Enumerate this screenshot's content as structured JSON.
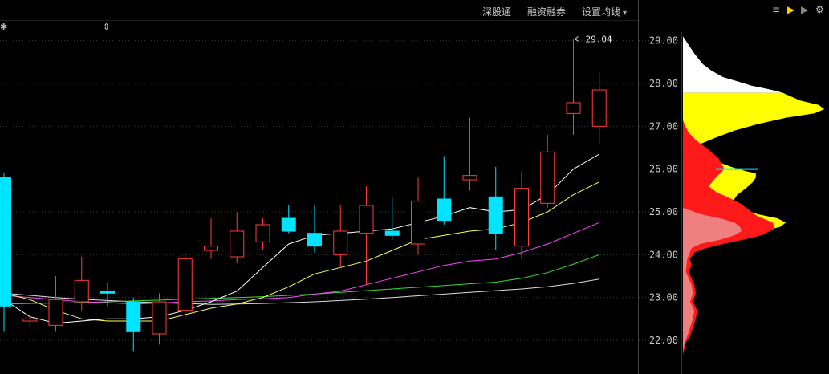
{
  "toolbar": {
    "links": [
      "深股通",
      "融资融券",
      "设置均线"
    ],
    "dropdown_arrow": "▾"
  },
  "side_tools": [
    {
      "name": "list-icon",
      "glyph": "≡",
      "color": "#bbbbbb"
    },
    {
      "name": "play-icon-yellow",
      "glyph": "▶",
      "color": "#ffd000"
    },
    {
      "name": "play-icon-gray",
      "glyph": "▶",
      "color": "#888888"
    },
    {
      "name": "gear-icon",
      "glyph": "⚙",
      "color": "#bbbbbb"
    }
  ],
  "left_glyphs": {
    "star": "✱",
    "updown": "⇕"
  },
  "colors": {
    "up": "#ff3c3c",
    "down": "#00e5ff",
    "ma5": "#ffffff",
    "ma10": "#ffff55",
    "ma20": "#ff44ff",
    "ma30": "#33dd33",
    "ma60": "#dddddd",
    "grid": "#3a3a3a"
  },
  "chart_data": {
    "type": "candlestick",
    "ylim": [
      21.4,
      29.8
    ],
    "y_ticks": [
      "29.00",
      "28.00",
      "27.00",
      "26.00",
      "25.00",
      "24.00",
      "23.00",
      "22.00"
    ],
    "max_label": "29.04",
    "candles": [
      {
        "o": 25.8,
        "h": 25.9,
        "l": 22.2,
        "c": 22.8
      },
      {
        "o": 22.45,
        "h": 22.6,
        "l": 22.3,
        "c": 22.5
      },
      {
        "o": 22.35,
        "h": 23.5,
        "l": 22.2,
        "c": 22.95
      },
      {
        "o": 22.9,
        "h": 23.95,
        "l": 22.7,
        "c": 23.4
      },
      {
        "o": 23.15,
        "h": 23.35,
        "l": 22.8,
        "c": 23.1
      },
      {
        "o": 22.9,
        "h": 23.0,
        "l": 21.75,
        "c": 22.2
      },
      {
        "o": 22.15,
        "h": 23.1,
        "l": 21.9,
        "c": 22.9
      },
      {
        "o": 22.7,
        "h": 24.05,
        "l": 22.5,
        "c": 23.9
      },
      {
        "o": 24.1,
        "h": 24.85,
        "l": 23.9,
        "c": 24.2
      },
      {
        "o": 23.95,
        "h": 25.0,
        "l": 23.8,
        "c": 24.55
      },
      {
        "o": 24.3,
        "h": 24.85,
        "l": 24.1,
        "c": 24.7
      },
      {
        "o": 24.85,
        "h": 25.15,
        "l": 24.5,
        "c": 24.55
      },
      {
        "o": 24.5,
        "h": 25.15,
        "l": 24.05,
        "c": 24.2
      },
      {
        "o": 24.0,
        "h": 25.15,
        "l": 23.7,
        "c": 24.55
      },
      {
        "o": 24.5,
        "h": 25.6,
        "l": 23.3,
        "c": 25.15
      },
      {
        "o": 24.55,
        "h": 25.35,
        "l": 24.35,
        "c": 24.45
      },
      {
        "o": 24.25,
        "h": 25.8,
        "l": 24.0,
        "c": 25.25
      },
      {
        "o": 25.3,
        "h": 26.3,
        "l": 24.7,
        "c": 24.8
      },
      {
        "o": 25.75,
        "h": 27.2,
        "l": 25.5,
        "c": 25.85
      },
      {
        "o": 25.35,
        "h": 26.05,
        "l": 24.1,
        "c": 24.5
      },
      {
        "o": 24.2,
        "h": 25.95,
        "l": 23.9,
        "c": 25.55
      },
      {
        "o": 25.2,
        "h": 26.8,
        "l": 25.1,
        "c": 26.4
      },
      {
        "o": 27.3,
        "h": 29.04,
        "l": 26.8,
        "c": 27.55
      },
      {
        "o": 27.0,
        "h": 28.25,
        "l": 26.6,
        "c": 27.85
      }
    ],
    "ma5": [
      22.95,
      22.55,
      22.4,
      22.45,
      22.5,
      22.5,
      22.55,
      22.7,
      22.9,
      23.15,
      23.7,
      24.25,
      24.45,
      24.5,
      24.55,
      24.6,
      24.75,
      24.9,
      25.1,
      25.0,
      25.05,
      25.4,
      26.0,
      26.35
    ],
    "ma10": [
      23.1,
      22.95,
      22.7,
      22.5,
      22.45,
      22.45,
      22.45,
      22.6,
      22.75,
      22.85,
      23.0,
      23.25,
      23.55,
      23.7,
      23.85,
      24.1,
      24.35,
      24.45,
      24.55,
      24.6,
      24.75,
      25.0,
      25.4,
      25.7
    ],
    "ma20": [
      23.05,
      23.0,
      22.95,
      22.9,
      22.88,
      22.85,
      22.87,
      22.9,
      22.92,
      22.95,
      22.97,
      23.0,
      23.08,
      23.15,
      23.3,
      23.45,
      23.6,
      23.75,
      23.85,
      23.9,
      24.05,
      24.25,
      24.5,
      24.75
    ],
    "ma30": [
      22.85,
      22.86,
      22.87,
      22.88,
      22.9,
      22.92,
      22.94,
      22.96,
      22.98,
      23.0,
      23.02,
      23.05,
      23.08,
      23.12,
      23.16,
      23.2,
      23.24,
      23.28,
      23.32,
      23.36,
      23.45,
      23.58,
      23.78,
      24.0
    ],
    "ma60": [
      23.1,
      23.05,
      23.0,
      22.96,
      22.93,
      22.9,
      22.88,
      22.86,
      22.84,
      22.85,
      22.86,
      22.88,
      22.9,
      22.93,
      22.96,
      23.0,
      23.04,
      23.08,
      23.12,
      23.16,
      23.2,
      23.25,
      23.33,
      23.43
    ],
    "chip_distribution": {
      "white": [
        [
          29.1,
          0
        ],
        [
          28.95,
          0.03
        ],
        [
          28.7,
          0.08
        ],
        [
          28.45,
          0.14
        ],
        [
          28.3,
          0.2
        ],
        [
          28.15,
          0.28
        ],
        [
          28.05,
          0.38
        ],
        [
          27.95,
          0.48
        ],
        [
          27.88,
          0.58
        ],
        [
          27.82,
          0.66
        ],
        [
          27.78,
          0.7
        ]
      ],
      "yellow": [
        [
          27.78,
          0.7
        ],
        [
          27.6,
          0.82
        ],
        [
          27.5,
          0.95
        ],
        [
          27.4,
          0.99
        ],
        [
          27.3,
          0.92
        ],
        [
          27.2,
          0.72
        ],
        [
          27.05,
          0.52
        ],
        [
          26.9,
          0.36
        ],
        [
          26.75,
          0.24
        ],
        [
          26.6,
          0.13
        ],
        [
          26.45,
          0.09
        ],
        [
          26.35,
          0.11
        ],
        [
          26.25,
          0.17
        ],
        [
          26.15,
          0.26
        ],
        [
          26.05,
          0.34
        ],
        [
          25.95,
          0.44
        ],
        [
          25.9,
          0.51
        ],
        [
          25.8,
          0.51
        ],
        [
          25.7,
          0.49
        ],
        [
          25.55,
          0.44
        ],
        [
          25.4,
          0.38
        ],
        [
          25.25,
          0.35
        ],
        [
          25.1,
          0.4
        ],
        [
          24.95,
          0.52
        ],
        [
          24.85,
          0.66
        ],
        [
          24.75,
          0.72
        ],
        [
          24.65,
          0.68
        ],
        [
          24.55,
          0.55
        ],
        [
          24.45,
          0.44
        ],
        [
          24.35,
          0.33
        ],
        [
          24.25,
          0.22
        ],
        [
          24.15,
          0.1
        ],
        [
          24.05,
          0.04
        ],
        [
          23.9,
          0.01
        ]
      ],
      "red": [
        [
          27.15,
          0
        ],
        [
          27.05,
          0.01
        ],
        [
          26.85,
          0.04
        ],
        [
          26.65,
          0.1
        ],
        [
          26.45,
          0.18
        ],
        [
          26.25,
          0.25
        ],
        [
          26.0,
          0.29
        ],
        [
          25.8,
          0.23
        ],
        [
          25.6,
          0.18
        ],
        [
          25.45,
          0.24
        ],
        [
          25.35,
          0.31
        ],
        [
          25.2,
          0.4
        ],
        [
          25.05,
          0.46
        ],
        [
          24.9,
          0.52
        ],
        [
          24.75,
          0.63
        ],
        [
          24.6,
          0.64
        ],
        [
          24.45,
          0.55
        ],
        [
          24.35,
          0.42
        ],
        [
          24.25,
          0.28
        ],
        [
          24.15,
          0.16
        ],
        [
          24.05,
          0.08
        ],
        [
          23.9,
          0.05
        ],
        [
          23.75,
          0.06
        ],
        [
          23.6,
          0.04
        ],
        [
          23.45,
          0.06
        ],
        [
          23.3,
          0.08
        ],
        [
          23.1,
          0.09
        ],
        [
          22.9,
          0.07
        ],
        [
          22.7,
          0.1
        ],
        [
          22.5,
          0.09
        ],
        [
          22.3,
          0.07
        ],
        [
          22.1,
          0.05
        ],
        [
          21.95,
          0.02
        ],
        [
          21.8,
          0.01
        ],
        [
          21.65,
          0
        ]
      ],
      "pink": [
        [
          25.1,
          0
        ],
        [
          24.95,
          0.12
        ],
        [
          24.85,
          0.26
        ],
        [
          24.75,
          0.36
        ],
        [
          24.65,
          0.4
        ],
        [
          24.55,
          0.41
        ],
        [
          24.45,
          0.36
        ],
        [
          24.35,
          0.26
        ],
        [
          24.25,
          0.12
        ],
        [
          24.15,
          0.06
        ],
        [
          23.9,
          0.03
        ],
        [
          23.6,
          0.02
        ],
        [
          23.3,
          0.06
        ],
        [
          23.1,
          0.07
        ],
        [
          22.9,
          0.05
        ],
        [
          22.7,
          0.08
        ],
        [
          22.5,
          0.07
        ],
        [
          22.3,
          0.05
        ],
        [
          22.1,
          0.03
        ],
        [
          21.9,
          0.01
        ],
        [
          21.75,
          0
        ]
      ],
      "cyan_line_price": 26.0
    }
  }
}
